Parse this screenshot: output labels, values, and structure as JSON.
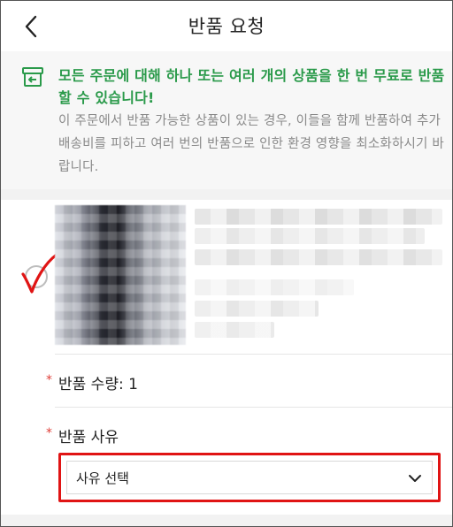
{
  "header": {
    "title": "반품 요청",
    "back_icon": "chevron-left-icon"
  },
  "notice": {
    "icon": "return-box-icon",
    "accent_color": "#2a9a4a",
    "headline": "모든 주문에 대해 하나 또는 여러 개의 상품을 한 번 무료로 반품할 수 있습니다!",
    "body": "이 주문에서 반품 가능한 상품이 있는 경우, 이들을 함께 반품하여 추가 배송비를 피하고 여러 번의 반품으로 인한 환경 영향을 최소화하시기 바랍니다."
  },
  "product": {
    "selected": true,
    "annotation_color": "#e01414"
  },
  "form": {
    "required_mark": "*",
    "quantity_label": "반품 수량: 1",
    "reason_label": "반품 사유",
    "reason_select": {
      "value": "사유 선택",
      "icon": "chevron-down-icon",
      "highlight_color": "#e01414"
    }
  }
}
